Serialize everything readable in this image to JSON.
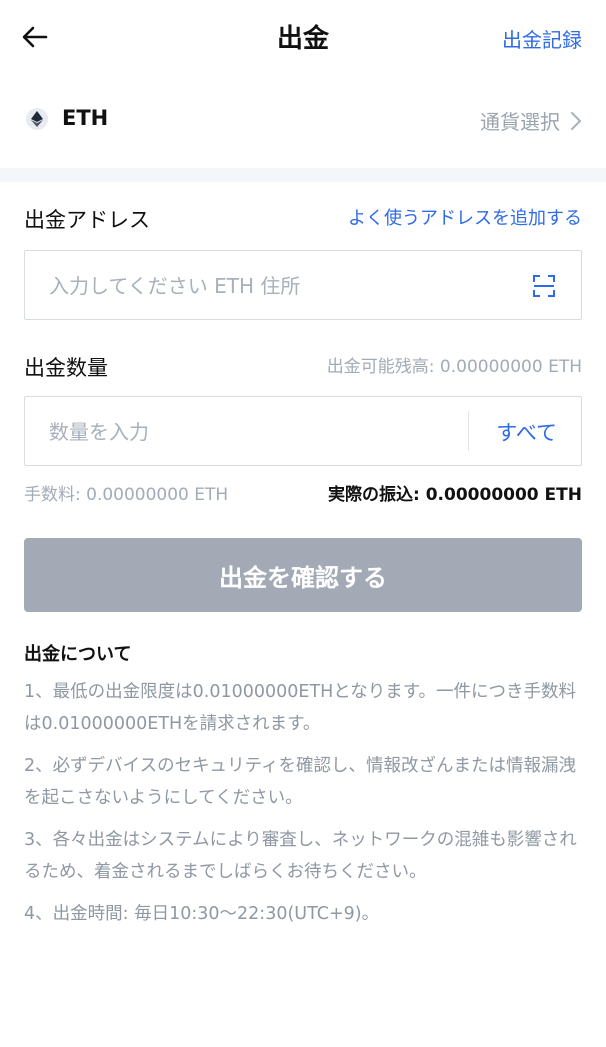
{
  "header": {
    "title": "出金",
    "history_link": "出金記録"
  },
  "currency": {
    "symbol": "ETH",
    "select_label": "通貨選択",
    "icon": "ethereum-icon"
  },
  "address": {
    "label": "出金アドレス",
    "add_frequent": "よく使うアドレスを追加する",
    "placeholder": "入力してください ETH 住所",
    "scan_icon": "scan-icon"
  },
  "amount": {
    "label": "出金数量",
    "available": "出金可能残高: 0.00000000 ETH",
    "placeholder": "数量を入力",
    "all_button": "すべて"
  },
  "fees": {
    "fee": "手数料: 0.00000000 ETH",
    "actual": "実際の振込: 0.00000000 ETH"
  },
  "confirm_button": "出金を確認する",
  "about": {
    "title": "出金について",
    "notes": [
      "1、最低の出金限度は0.01000000ETHとなります。一件につき手数料は0.01000000ETHを請求されます。",
      "2、必ずデバイスのセキュリティを確認し、情報改ざんまたは情報漏洩を起こさないようにしてください。",
      "3、各々出金はシステムにより審査し、ネットワークの混雑も影響されるため、着金されるまでしばらくお待ちください。",
      "4、出金時間: 毎日10:30～22:30(UTC+9)。"
    ]
  },
  "colors": {
    "accent": "#2f6be8",
    "button_disabled": "#a3aab6",
    "muted_text": "#a2abb6",
    "band": "#f4f6f9"
  }
}
